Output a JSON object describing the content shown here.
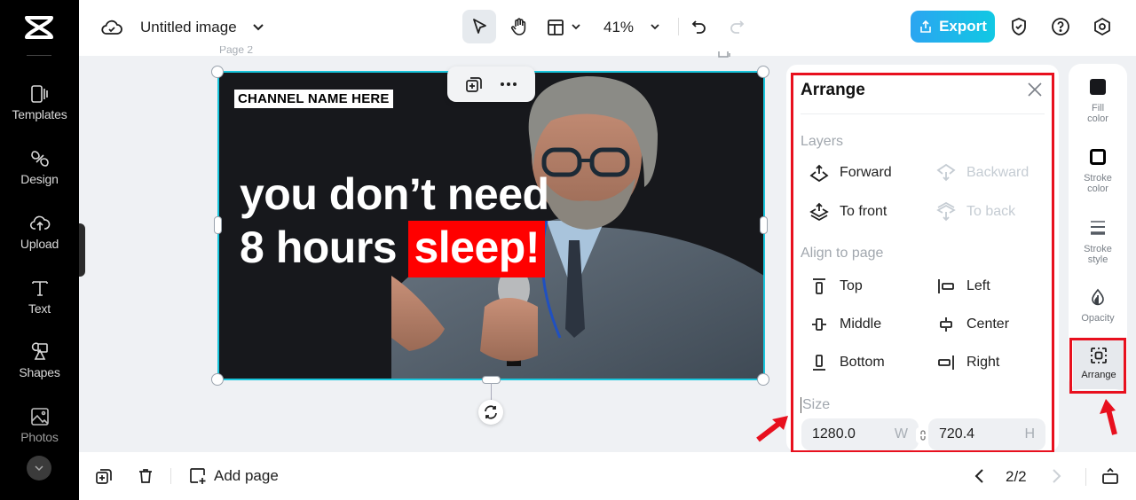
{
  "app": {
    "logo": "capcut-logo-icon"
  },
  "sidebar": {
    "items": [
      {
        "label": "Templates",
        "icon": "templates-icon"
      },
      {
        "label": "Design",
        "icon": "design-icon"
      },
      {
        "label": "Upload",
        "icon": "upload-icon"
      },
      {
        "label": "Text",
        "icon": "text-icon"
      },
      {
        "label": "Shapes",
        "icon": "shapes-icon"
      },
      {
        "label": "Photos",
        "icon": "photos-icon"
      }
    ],
    "more_icon": "chevron-down-icon"
  },
  "topbar": {
    "doc_title": "Untitled image",
    "zoom": "41%",
    "export_label": "Export"
  },
  "canvas": {
    "page_label": "Page 2",
    "channel_name": "CHANNEL NAME HERE",
    "headline_line1": "you don’t need",
    "headline_line2_prefix": "8 hours ",
    "headline_highlight": "sleep!",
    "highlight_color": "#ff0000",
    "selection_color": "#19c5dc"
  },
  "arrange_panel": {
    "title": "Arrange",
    "layers_label": "Layers",
    "layers": [
      {
        "label": "Forward",
        "enabled": true
      },
      {
        "label": "Backward",
        "enabled": false
      },
      {
        "label": "To front",
        "enabled": true
      },
      {
        "label": "To back",
        "enabled": false
      }
    ],
    "align_label": "Align to page",
    "align": [
      {
        "label": "Top"
      },
      {
        "label": "Left"
      },
      {
        "label": "Middle"
      },
      {
        "label": "Center"
      },
      {
        "label": "Bottom"
      },
      {
        "label": "Right"
      }
    ],
    "size_label": "Size",
    "width_value": "1280.0",
    "width_unit": "W",
    "height_value": "720.4",
    "height_unit": "H"
  },
  "props": {
    "items": [
      {
        "label": "Fill color"
      },
      {
        "label": "Stroke color"
      },
      {
        "label": "Stroke style"
      },
      {
        "label": "Opacity"
      },
      {
        "label": "Arrange",
        "active": true
      }
    ]
  },
  "bottombar": {
    "add_page_label": "Add page",
    "page_indicator": "2/2"
  },
  "annotation": {
    "highlight_color": "#e8101e"
  }
}
